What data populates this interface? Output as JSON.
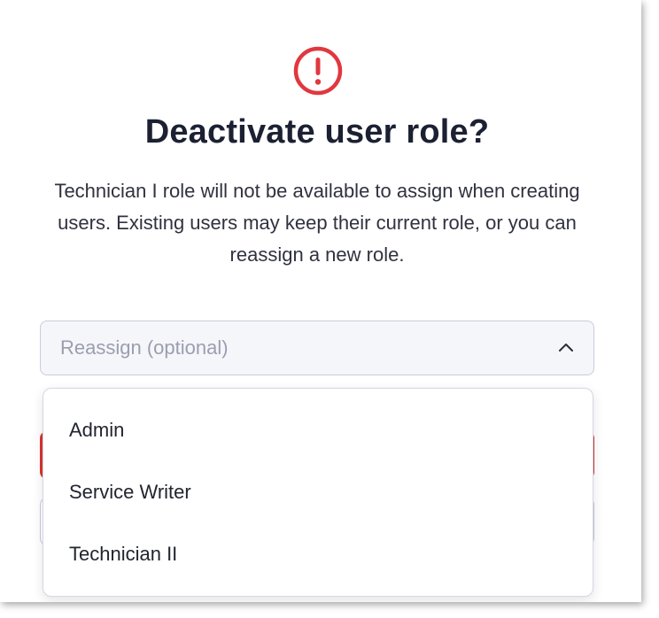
{
  "dialog": {
    "title": "Deactivate user role?",
    "message": "Technician I role will not be available to assign when creating users. Existing users may keep their current role, or you can reassign a new role.",
    "icon": "alert-circle-icon",
    "accent_color": "#e0383e"
  },
  "reassign": {
    "placeholder": "Reassign (optional)",
    "expanded": true,
    "options": [
      {
        "label": "Admin"
      },
      {
        "label": "Service Writer"
      },
      {
        "label": "Technician II"
      }
    ]
  },
  "colors": {
    "primary_danger": "#d9342b",
    "text_dark": "#1c2033",
    "placeholder_text": "#9a9eaf"
  }
}
